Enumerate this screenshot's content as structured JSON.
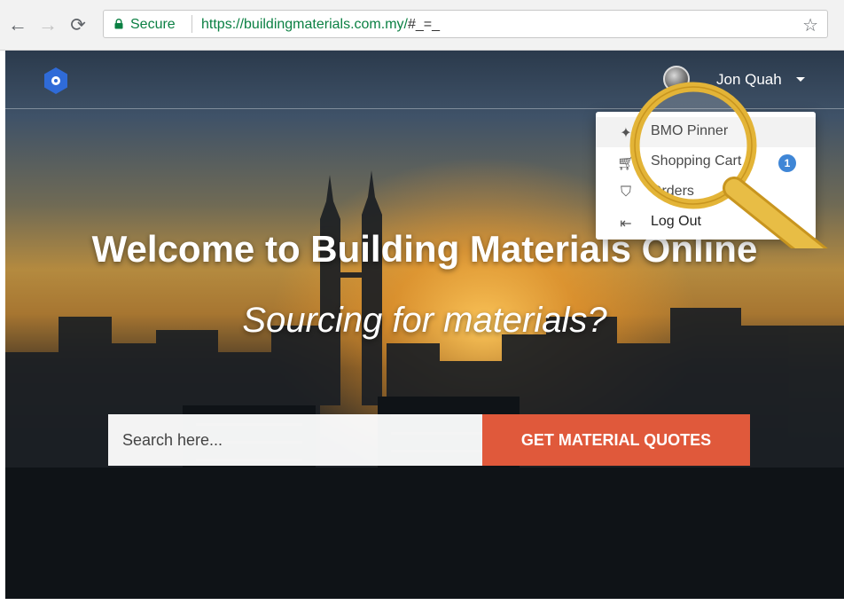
{
  "browser": {
    "secure_label": "Secure",
    "url_host": "https://buildingmaterials.com.my/",
    "url_path": "#_=_"
  },
  "nav": {
    "user_name": "Jon Quah"
  },
  "hero": {
    "headline": "Welcome to Building Materials Online",
    "subheadline": "Sourcing for materials?",
    "search_placeholder": "Search here...",
    "cta_label": "GET MATERIAL QUOTES"
  },
  "dropdown": {
    "items": [
      {
        "icon": "pin-icon",
        "label": "BMO Pinner"
      },
      {
        "icon": "cart-icon",
        "label": "Shopping Cart",
        "badge": "1"
      },
      {
        "icon": "basket-icon",
        "label": "Orders"
      },
      {
        "icon": "logout-icon",
        "label": "Log Out"
      }
    ]
  },
  "colors": {
    "accent": "#e0593b",
    "badge": "#3f86d6",
    "secure_green": "#0b8043",
    "magnifier_ring": "#e3b437"
  }
}
